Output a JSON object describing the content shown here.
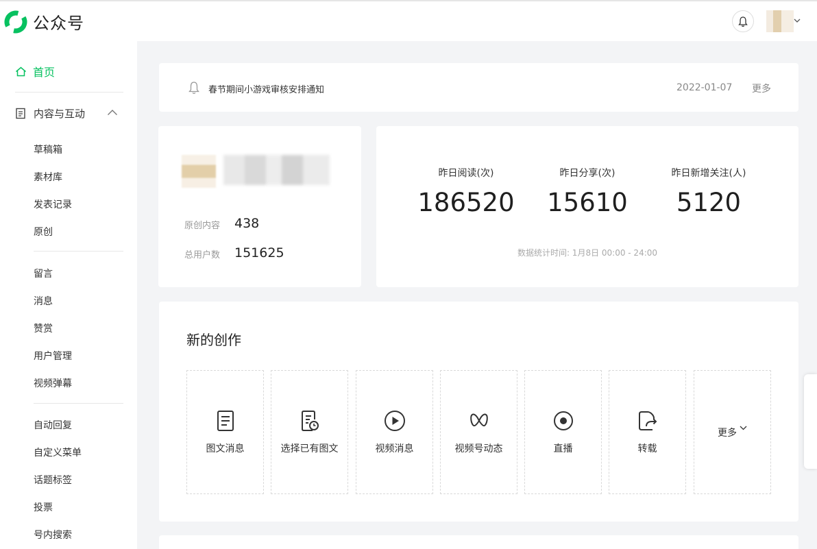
{
  "header": {
    "brand_name": "公众号",
    "bell_icon": "bell-icon",
    "avatar_icon": "avatar"
  },
  "sidebar": {
    "home": "首页",
    "group_label": "内容与互动",
    "items_a": [
      "草稿箱",
      "素材库",
      "发表记录",
      "原创"
    ],
    "items_b": [
      "留言",
      "消息",
      "赞赏",
      "用户管理",
      "视频弹幕"
    ],
    "items_c": [
      "自动回复",
      "自定义菜单",
      "话题标签",
      "投票",
      "号内搜索"
    ]
  },
  "notice": {
    "text": "春节期间小游戏审核安排通知",
    "date": "2022-01-07",
    "more": "更多"
  },
  "account": {
    "original_label": "原创内容",
    "original_value": "438",
    "users_label": "总用户数",
    "users_value": "151625"
  },
  "stats": {
    "items": [
      {
        "label": "昨日阅读(次)",
        "value": "186520"
      },
      {
        "label": "昨日分享(次)",
        "value": "15610"
      },
      {
        "label": "昨日新增关注(人)",
        "value": "5120"
      }
    ],
    "time_note": "数据统计时间: 1月8日 00:00 - 24:00"
  },
  "create": {
    "title": "新的创作",
    "tiles": [
      {
        "label": "图文消息",
        "icon": "article-icon"
      },
      {
        "label": "选择已有图文",
        "icon": "existing-article-icon"
      },
      {
        "label": "视频消息",
        "icon": "video-play-icon"
      },
      {
        "label": "视频号动态",
        "icon": "channels-icon"
      },
      {
        "label": "直播",
        "icon": "live-icon"
      },
      {
        "label": "转载",
        "icon": "repost-icon"
      }
    ],
    "more": "更多"
  },
  "colors": {
    "accent": "#07c160",
    "background": "#f3f4f6"
  }
}
